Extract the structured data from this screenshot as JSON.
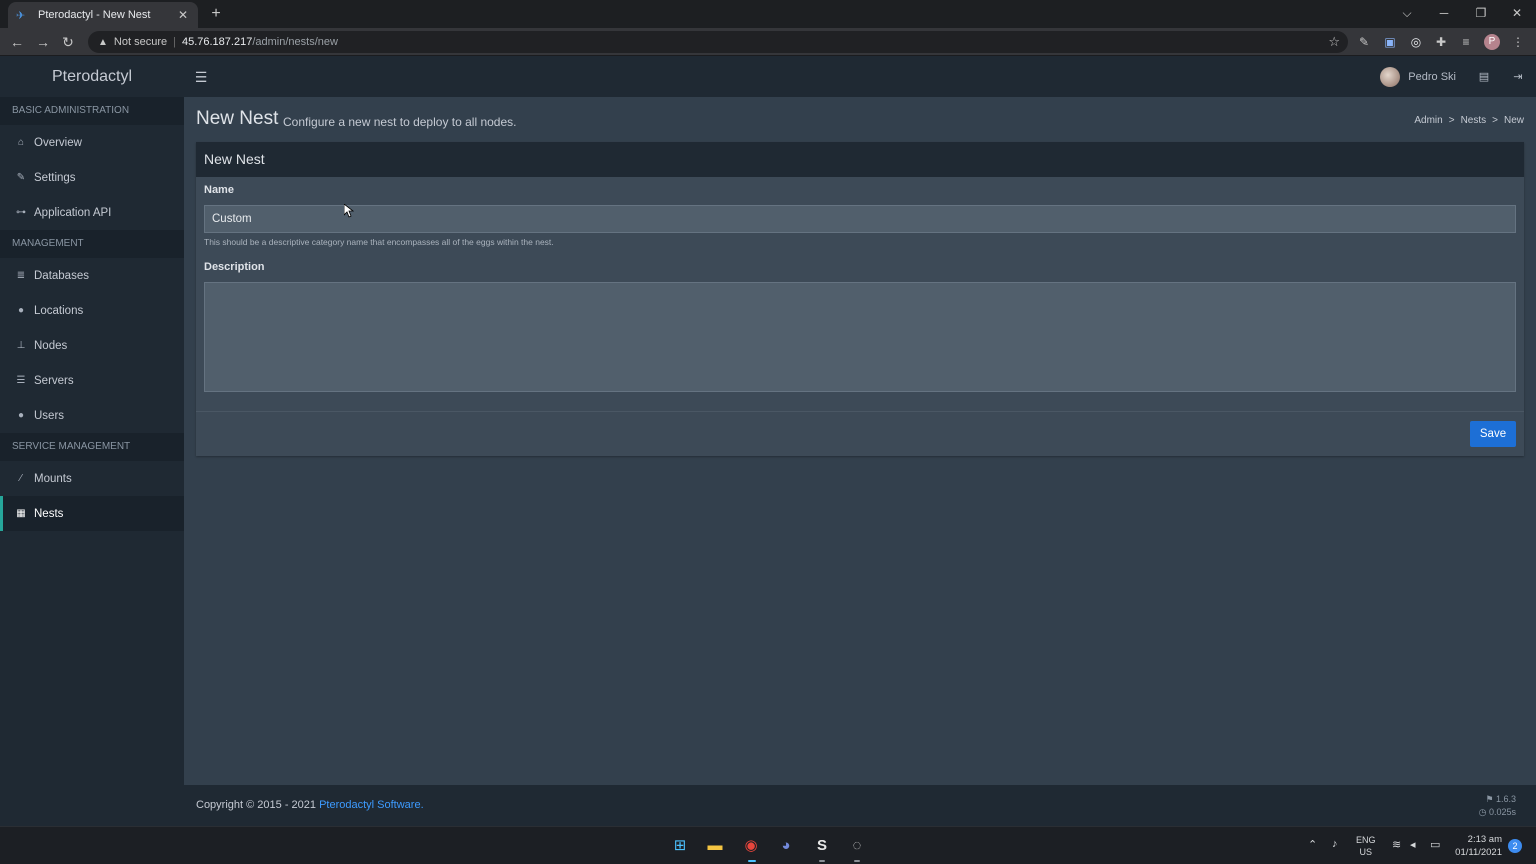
{
  "browser": {
    "tab_title": "Pterodactyl - New Nest",
    "tab_close": "✕",
    "new_tab": "+",
    "security_label": "Not secure",
    "url_host": "45.76.187.217",
    "url_path": "/admin/nests/new"
  },
  "header": {
    "brand": "Pterodactyl",
    "user_name": "Pedro Ski"
  },
  "sidebar": {
    "sections": [
      {
        "title": "BASIC ADMINISTRATION",
        "items": [
          {
            "label": "Overview",
            "icon": "home-icon"
          },
          {
            "label": "Settings",
            "icon": "wrench-icon"
          },
          {
            "label": "Application API",
            "icon": "gamepad-icon"
          }
        ]
      },
      {
        "title": "MANAGEMENT",
        "items": [
          {
            "label": "Databases",
            "icon": "database-icon"
          },
          {
            "label": "Locations",
            "icon": "globe-icon"
          },
          {
            "label": "Nodes",
            "icon": "sitemap-icon"
          },
          {
            "label": "Servers",
            "icon": "server-icon"
          },
          {
            "label": "Users",
            "icon": "users-icon"
          }
        ]
      },
      {
        "title": "SERVICE MANAGEMENT",
        "items": [
          {
            "label": "Mounts",
            "icon": "magic-icon"
          },
          {
            "label": "Nests",
            "icon": "th-large-icon",
            "active": true
          }
        ]
      }
    ]
  },
  "page": {
    "title": "New Nest",
    "subtitle": "Configure a new nest to deploy to all nodes.",
    "breadcrumb": [
      "Admin",
      "Nests",
      "New"
    ],
    "breadcrumb_sep": ">"
  },
  "form": {
    "header": "New Nest",
    "name_label": "Name",
    "name_value": "Custom",
    "name_help": "This should be a descriptive category name that encompasses all of the eggs within the nest.",
    "description_label": "Description",
    "description_value": "",
    "save_label": "Save"
  },
  "footer": {
    "copyright": "Copyright © 2015 - 2021",
    "link_text": "Pterodactyl Software.",
    "version": "1.6.3",
    "timing": "0.025s"
  },
  "taskbar": {
    "lang": "ENG",
    "region": "US",
    "time": "2:13 am",
    "date": "01/11/2021",
    "notifications": "2"
  },
  "colors": {
    "accent": "#26a69a",
    "primary_button": "#1d6fd6",
    "link": "#3d9bff"
  }
}
